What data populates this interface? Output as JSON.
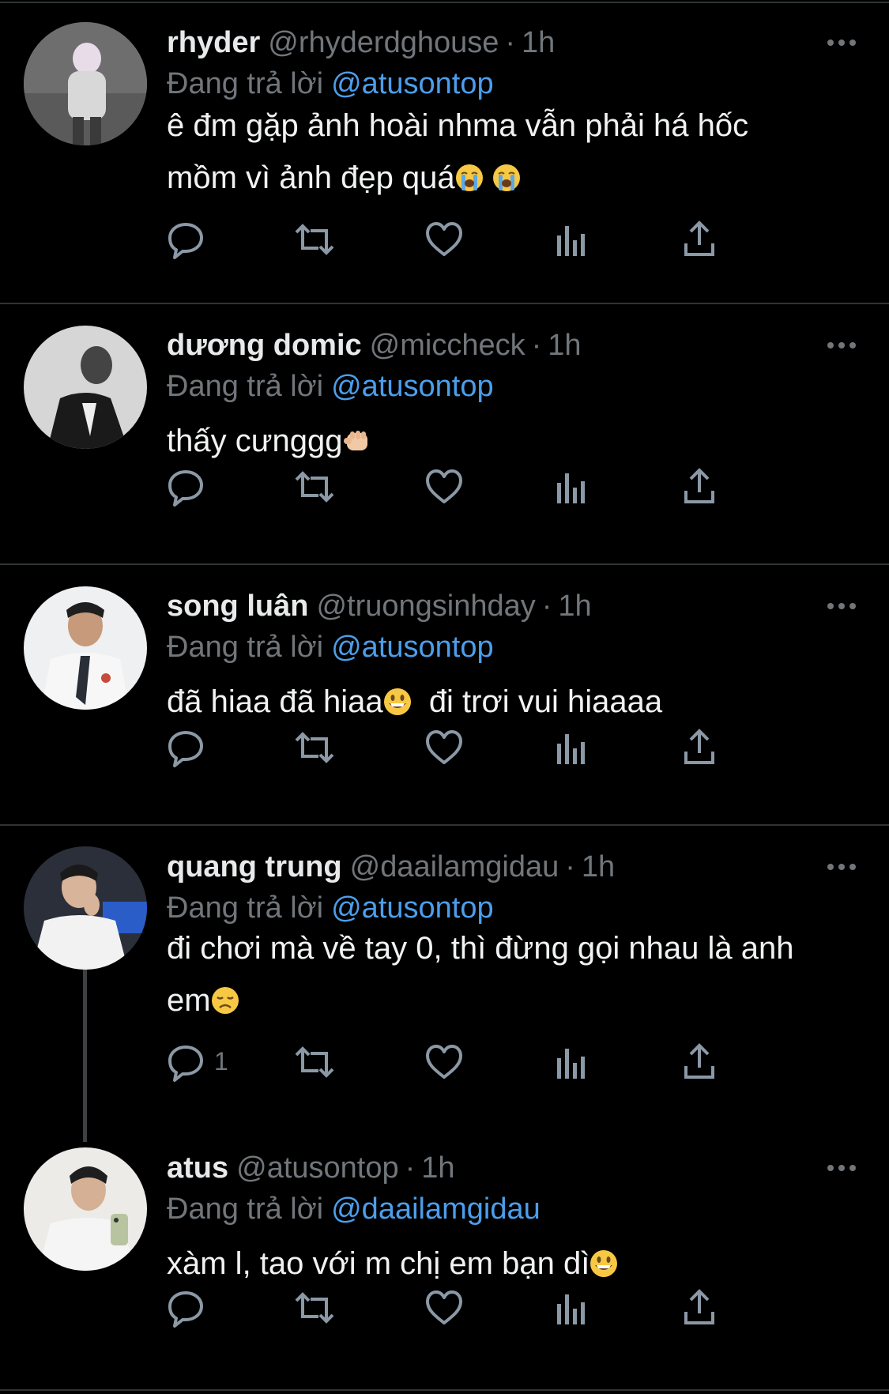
{
  "colors": {
    "background": "#000000",
    "text": "#e7e9ea",
    "secondary": "#71767b",
    "link": "#4c9eeb",
    "divider": "#2f3336"
  },
  "tweets": [
    {
      "name": "rhyder",
      "handle": "@rhyderdghouse",
      "time": "1h",
      "reply_prefix": "Đang trả lời",
      "reply_to": "@atusontop",
      "text_lines": [
        "ê đm gặp ảnh hoài nhma vẫn phải há hốc",
        "mồm vì ảnh đẹp quá"
      ],
      "emojis": [
        "loudly-crying-face",
        "loudly-crying-face"
      ],
      "reply_count": ""
    },
    {
      "name": "dương domic",
      "handle": "@miccheck",
      "time": "1h",
      "reply_prefix": "Đang trả lời",
      "reply_to": "@atusontop",
      "text_lines": [
        "thấy cưnggg"
      ],
      "emojis": [
        "punch"
      ],
      "reply_count": ""
    },
    {
      "name": "song luân",
      "handle": "@truongsinhday",
      "time": "1h",
      "reply_prefix": "Đang trả lời",
      "reply_to": "@atusontop",
      "text_lines": [
        "đã hiaa đã hiaa",
        "đi trơi vui hiaaaa"
      ],
      "emojis": [
        "grinning-face"
      ],
      "reply_count": ""
    },
    {
      "name": "quang trung",
      "handle": "@daailamgidau",
      "time": "1h",
      "reply_prefix": "Đang trả lời",
      "reply_to": "@atusontop",
      "text_lines": [
        "đi chơi mà về tay 0, thì đừng gọi nhau là anh",
        "em"
      ],
      "emojis": [
        "disappointed-face"
      ],
      "reply_count": "1"
    },
    {
      "name": "atus",
      "handle": "@atusontop",
      "time": "1h",
      "reply_prefix": "Đang trả lời",
      "reply_to": "@daailamgidau",
      "text_lines": [
        "xàm l, tao với m chị em bạn dì"
      ],
      "emojis": [
        "grinning-face"
      ],
      "reply_count": ""
    }
  ],
  "separator": "·"
}
